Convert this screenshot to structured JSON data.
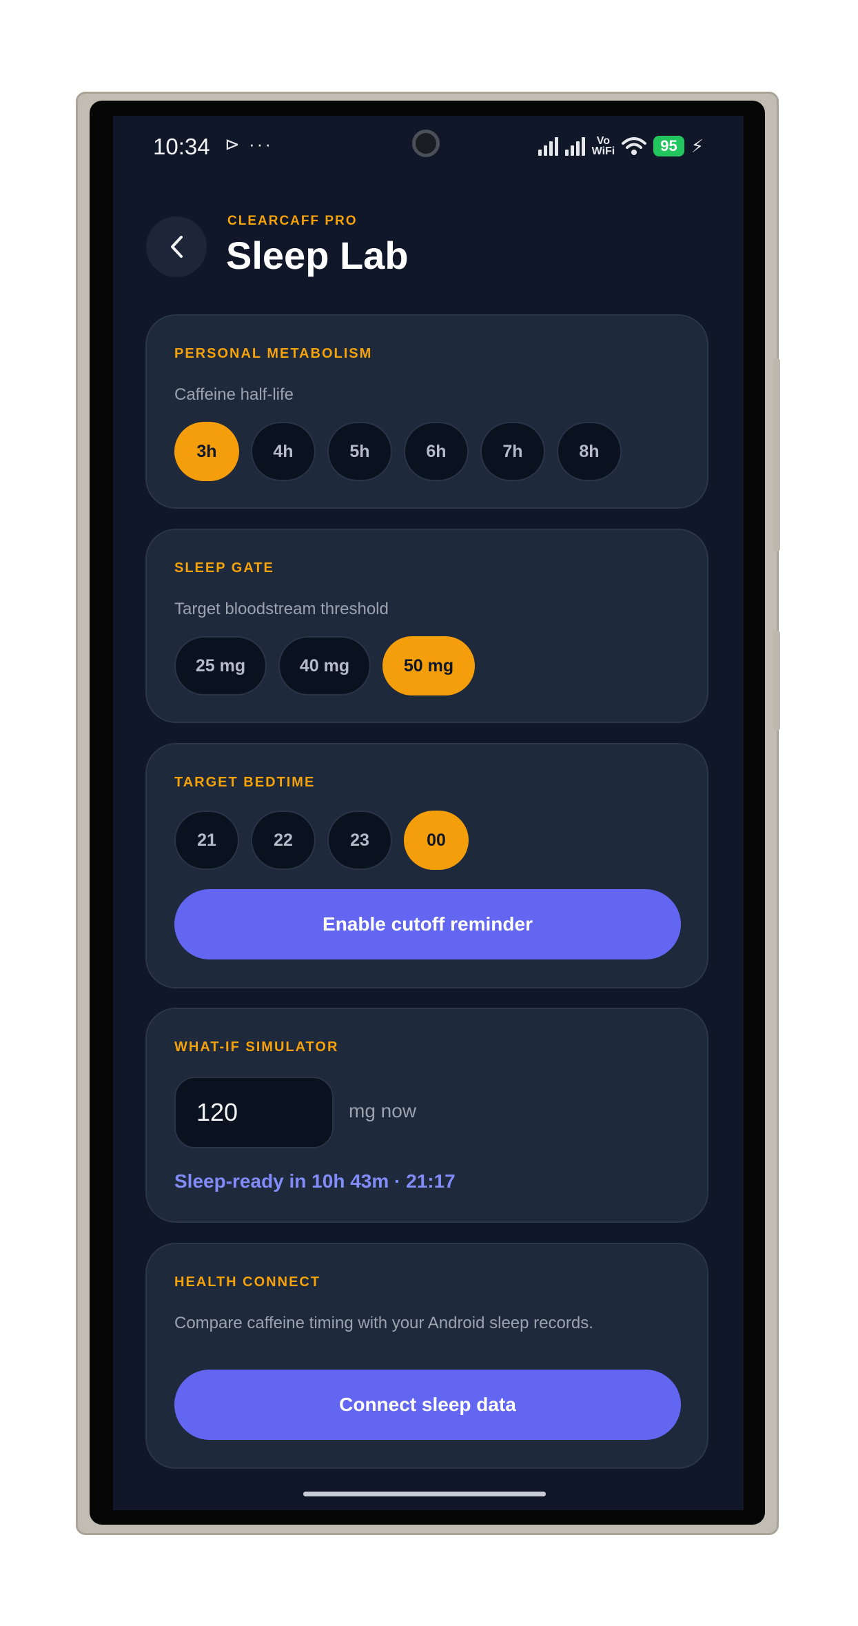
{
  "status_bar": {
    "time": "10:34",
    "left_icons": "⊳ ···",
    "vowifi": [
      "Vo",
      "WiFi"
    ],
    "battery": "95"
  },
  "header": {
    "back_icon": "chevron-left-icon",
    "app_name": "CLEARCAFF PRO",
    "title": "Sleep Lab"
  },
  "metabolism": {
    "title": "PERSONAL METABOLISM",
    "subtitle": "Caffeine half-life",
    "options": [
      "3h",
      "4h",
      "5h",
      "6h",
      "7h",
      "8h"
    ],
    "selected": "3h"
  },
  "sleep_gate": {
    "title": "SLEEP GATE",
    "subtitle": "Target bloodstream threshold",
    "options": [
      "25 mg",
      "40 mg",
      "50 mg"
    ],
    "selected": "50 mg"
  },
  "bedtime": {
    "title": "TARGET BEDTIME",
    "options": [
      "21",
      "22",
      "23",
      "00"
    ],
    "selected": "00",
    "button_label": "Enable cutoff reminder"
  },
  "simulator": {
    "title": "WHAT-IF SIMULATOR",
    "input_value": "120",
    "unit": "mg now",
    "result": "Sleep-ready in 10h 43m · 21:17"
  },
  "health_connect": {
    "title": "HEALTH CONNECT",
    "description": "Compare caffeine timing with your Android sleep records.",
    "button_label": "Connect sleep data"
  },
  "colors": {
    "background": "#0f1729",
    "card": "#1e293b",
    "accent": "#f59e0b",
    "primary": "#6366f1",
    "result": "#818cf8"
  }
}
